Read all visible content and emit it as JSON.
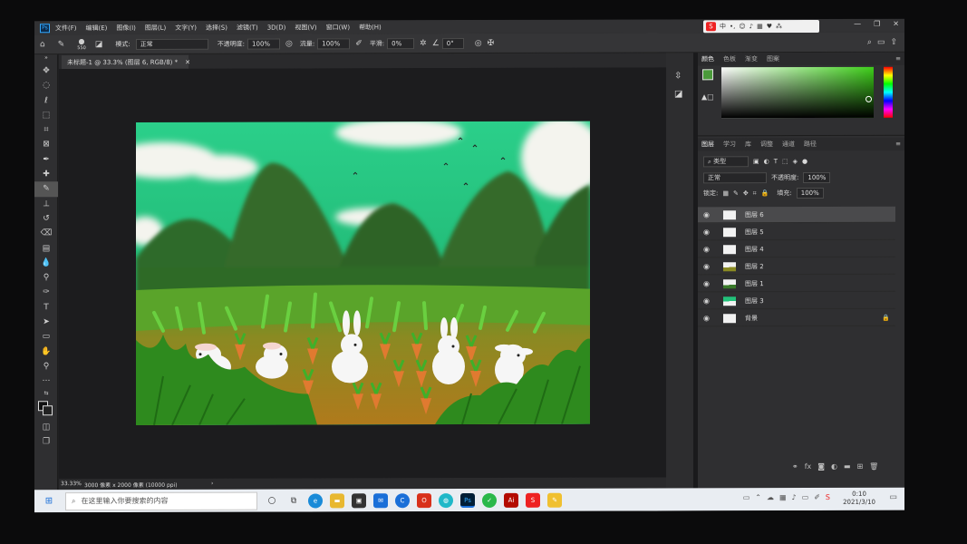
{
  "menubar": {
    "items": [
      "文件(F)",
      "编辑(E)",
      "图像(I)",
      "图层(L)",
      "文字(Y)",
      "选择(S)",
      "滤镜(T)",
      "3D(D)",
      "视图(V)",
      "窗口(W)",
      "帮助(H)"
    ]
  },
  "ime": {
    "lang": "中",
    "brand": "S"
  },
  "options": {
    "brush_size": "550",
    "mode_label": "模式:",
    "mode_value": "正常",
    "opacity_label": "不透明度:",
    "opacity_value": "100%",
    "flow_label": "流量:",
    "flow_value": "100%",
    "smooth_label": "平滑:",
    "smooth_value": "0%",
    "angle_value": "0°"
  },
  "document": {
    "tab_title": "未标题-1 @ 33.3% (图层 6, RGB/8) *",
    "status_zoom": "33.33%",
    "status_info": "3000 像素 x 2000 像素 (10000 ppi)"
  },
  "color_panel": {
    "tabs": [
      "颜色",
      "色板",
      "渐变",
      "图案"
    ],
    "fg_color": "#4a9a3a",
    "accent": "#3ecf1a"
  },
  "layers_panel": {
    "tabs": [
      "图层",
      "学习",
      "库",
      "调整",
      "通道",
      "路径"
    ],
    "filter_label": "类型",
    "blend_mode": "正常",
    "opacity_label": "不透明度:",
    "opacity_value": "100%",
    "lock_label": "锁定:",
    "fill_label": "填充:",
    "fill_value": "100%",
    "layers": [
      {
        "name": "图层 6"
      },
      {
        "name": "图层 5"
      },
      {
        "name": "图层 4"
      },
      {
        "name": "图层 2"
      },
      {
        "name": "图层 1"
      },
      {
        "name": "图层 3"
      },
      {
        "name": "背景"
      }
    ]
  },
  "taskbar": {
    "search_placeholder": "在这里输入你要搜索的内容",
    "time": "0:10",
    "date": "2021/3/10"
  }
}
